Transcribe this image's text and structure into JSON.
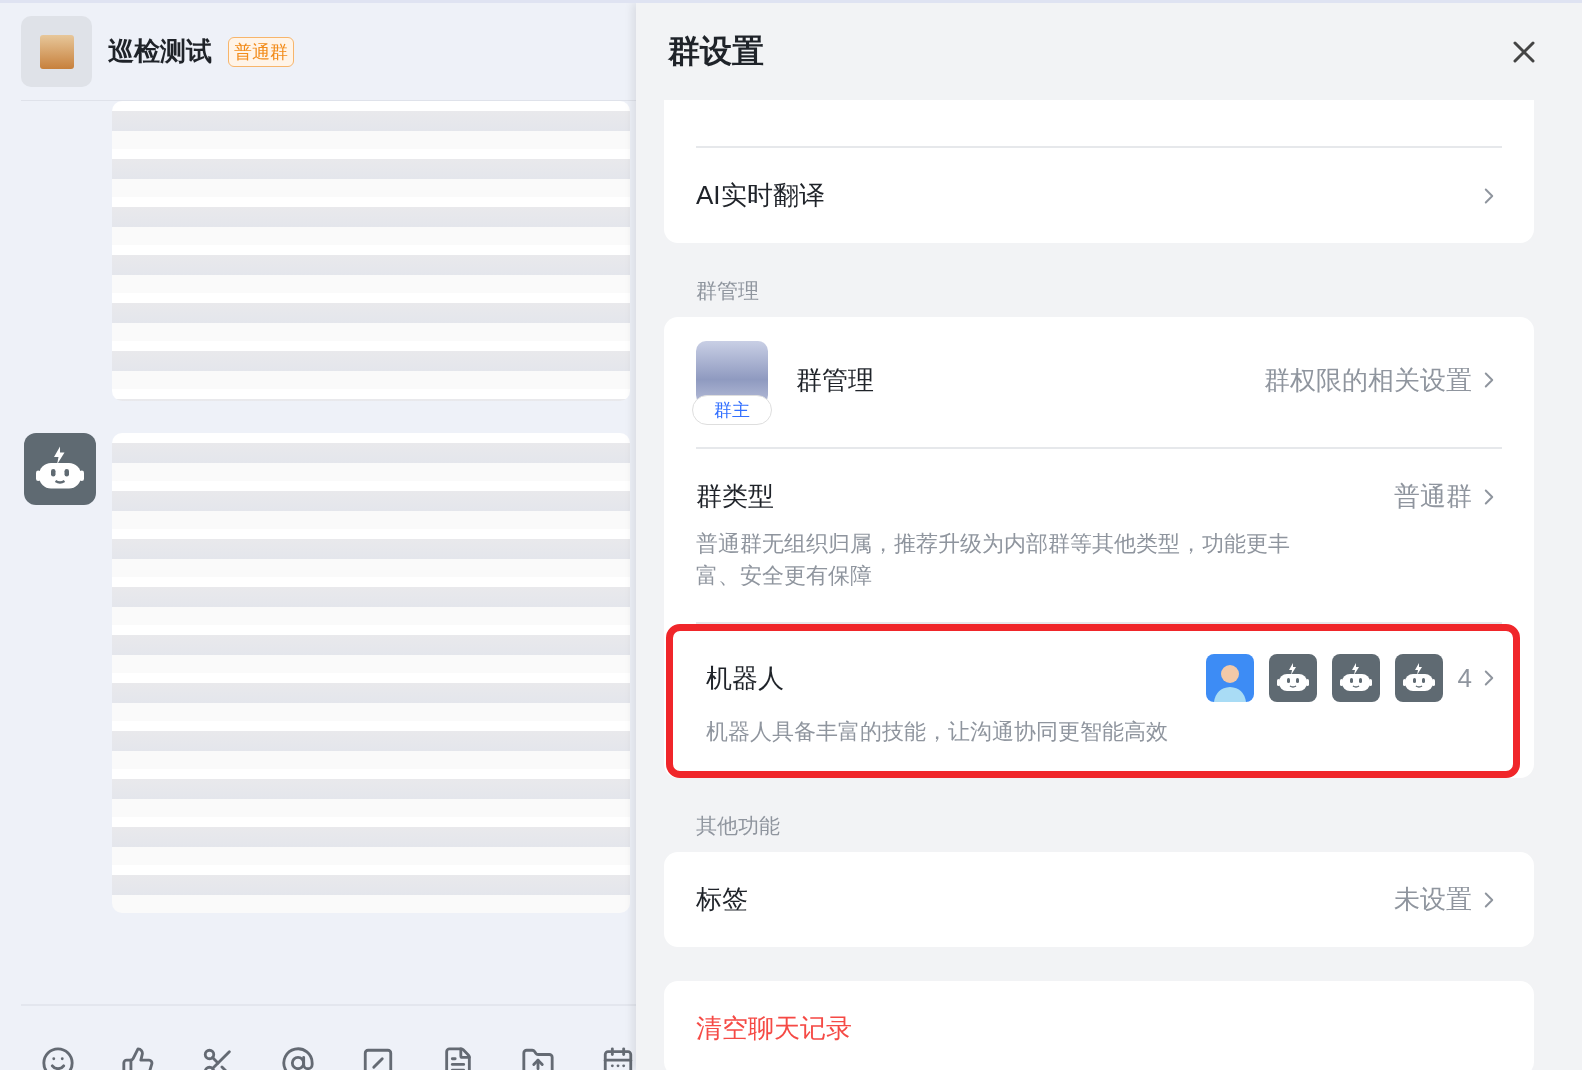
{
  "chat": {
    "title": "巡检测试",
    "tag": "普通群"
  },
  "settings": {
    "title": "群设置",
    "cards": [
      {
        "rows": [
          {
            "kind": "link",
            "label": "AI实时翻译"
          }
        ]
      },
      {
        "heading": "群管理",
        "rows": [
          {
            "kind": "owner",
            "label": "群管理",
            "badge": "群主",
            "value": "群权限的相关设置"
          },
          {
            "kind": "link",
            "label": "群类型",
            "value": "普通群",
            "description": "普通群无组织归属，推荐升级为内部群等其他类型，功能更丰富、安全更有保障"
          },
          {
            "kind": "bots",
            "label": "机器人",
            "description": "机器人具备丰富的技能，让沟通协同更智能高效",
            "count": "4",
            "highlighted": true,
            "bots": [
              {
                "kind": "person"
              },
              {
                "kind": "robot"
              },
              {
                "kind": "robot"
              },
              {
                "kind": "robot"
              }
            ]
          }
        ]
      },
      {
        "heading": "其他功能",
        "rows": [
          {
            "kind": "link",
            "label": "标签",
            "value": "未设置"
          }
        ]
      },
      {
        "rows": [
          {
            "kind": "danger",
            "label": "清空聊天记录"
          }
        ]
      }
    ]
  }
}
